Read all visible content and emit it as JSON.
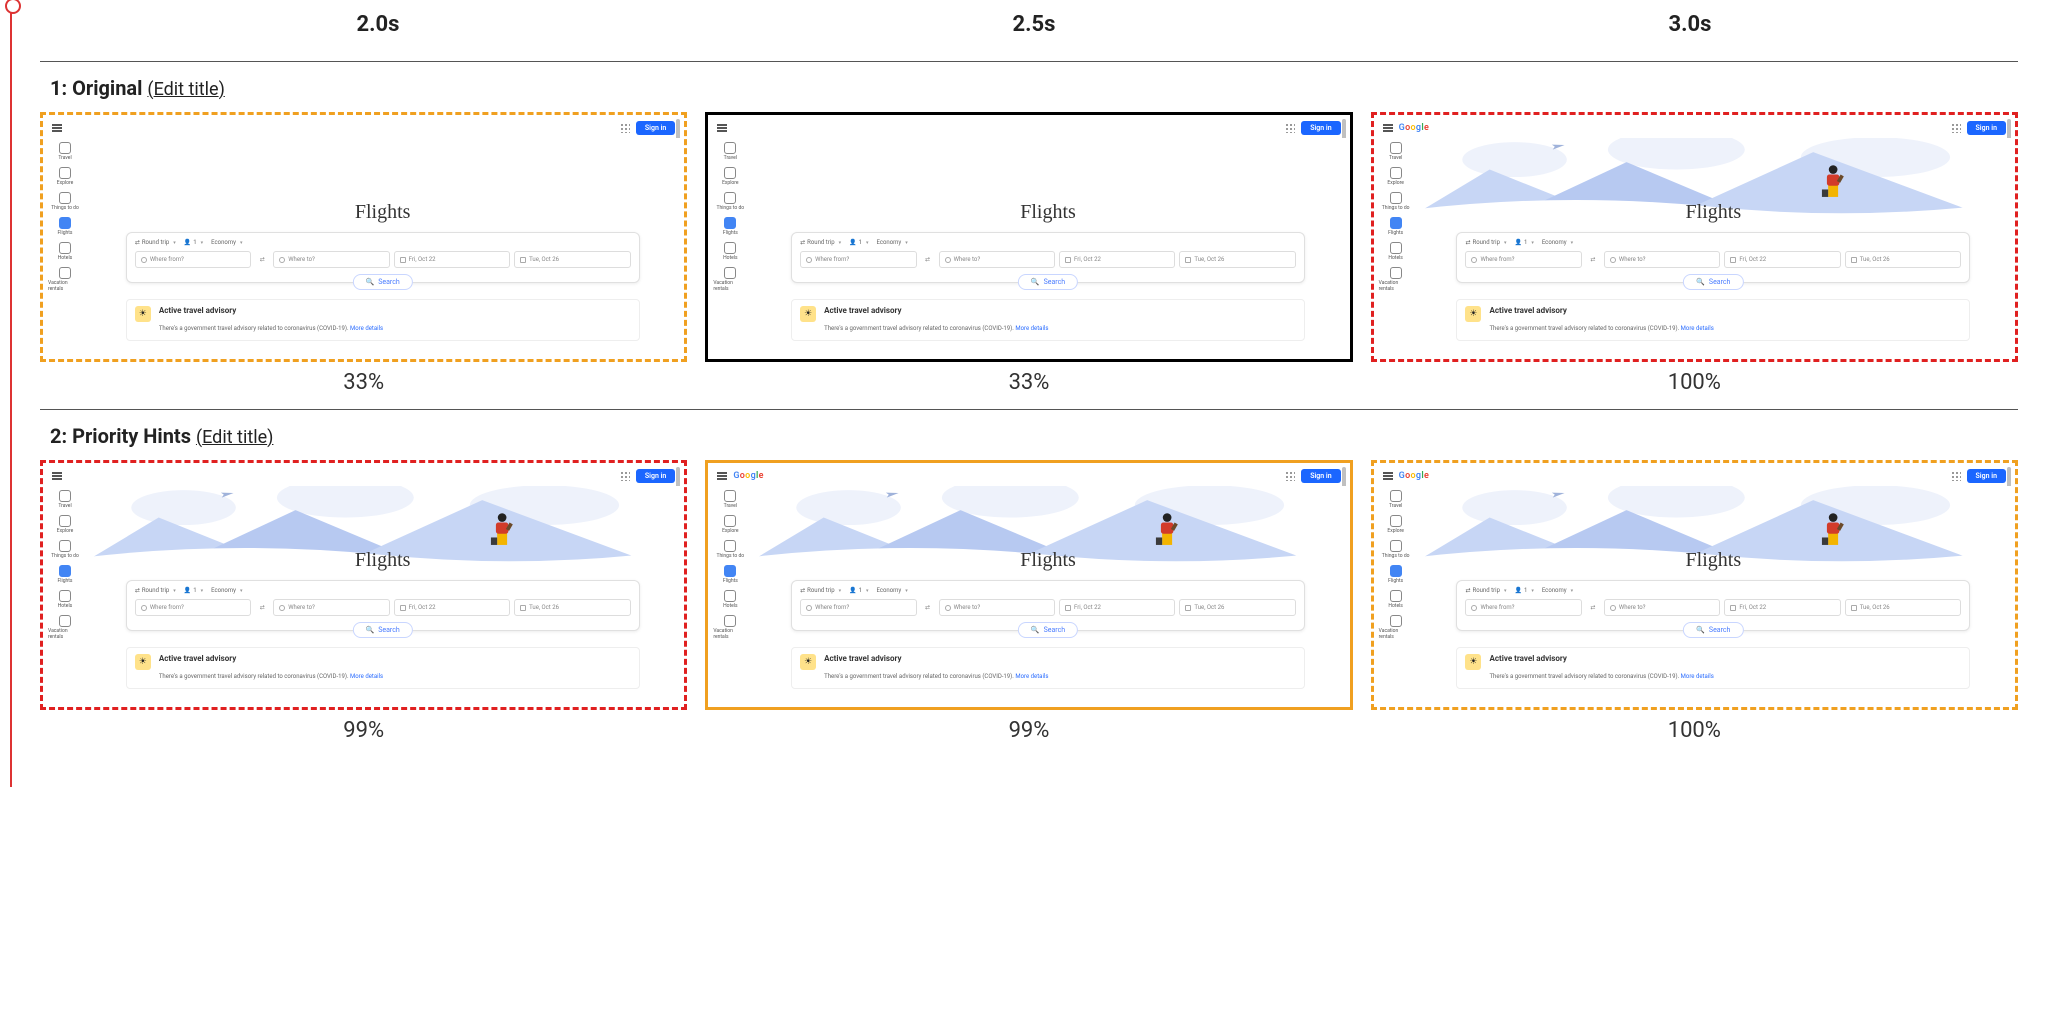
{
  "timestamps": [
    "2.0s",
    "2.5s",
    "3.0s"
  ],
  "series": [
    {
      "index": "1:",
      "name": "Original",
      "edit_label": "Edit title",
      "frames": [
        {
          "border": "dashed-orange",
          "with_nudge": true,
          "hero_loaded": false,
          "logo_shown": false,
          "percent": "33%"
        },
        {
          "border": "solid-black",
          "with_nudge": false,
          "hero_loaded": false,
          "logo_shown": false,
          "percent": "33%"
        },
        {
          "border": "dashed-red",
          "with_nudge": false,
          "hero_loaded": true,
          "logo_shown": true,
          "percent": "100%"
        }
      ]
    },
    {
      "index": "2:",
      "name": "Priority Hints",
      "edit_label": "Edit title",
      "frames": [
        {
          "border": "dashed-red",
          "with_nudge": true,
          "hero_loaded": true,
          "logo_shown": false,
          "percent": "99%"
        },
        {
          "border": "solid-orange",
          "with_nudge": false,
          "hero_loaded": true,
          "logo_shown": true,
          "percent": "99%"
        },
        {
          "border": "dashed-orange",
          "with_nudge": false,
          "hero_loaded": true,
          "logo_shown": true,
          "percent": "100%"
        }
      ]
    }
  ],
  "mock": {
    "logo": "Google",
    "signin": "Sign in",
    "hero_title": "Flights",
    "sidebar": [
      {
        "label": "Travel"
      },
      {
        "label": "Explore"
      },
      {
        "label": "Things to do"
      },
      {
        "label": "Flights",
        "active": true
      },
      {
        "label": "Hotels"
      },
      {
        "label": "Vacation rentals"
      }
    ],
    "chips": {
      "trip": "Round trip",
      "pax": "1",
      "class": "Economy"
    },
    "fields": {
      "from": "Where from?",
      "to": "Where to?",
      "depart": "Fri, Oct 22",
      "return": "Tue, Oct 26"
    },
    "search_btn": "Search",
    "advisory": {
      "title": "Active travel advisory",
      "body": "There's a government travel advisory related to coronavirus (COVID-19). ",
      "link": "More details"
    }
  }
}
